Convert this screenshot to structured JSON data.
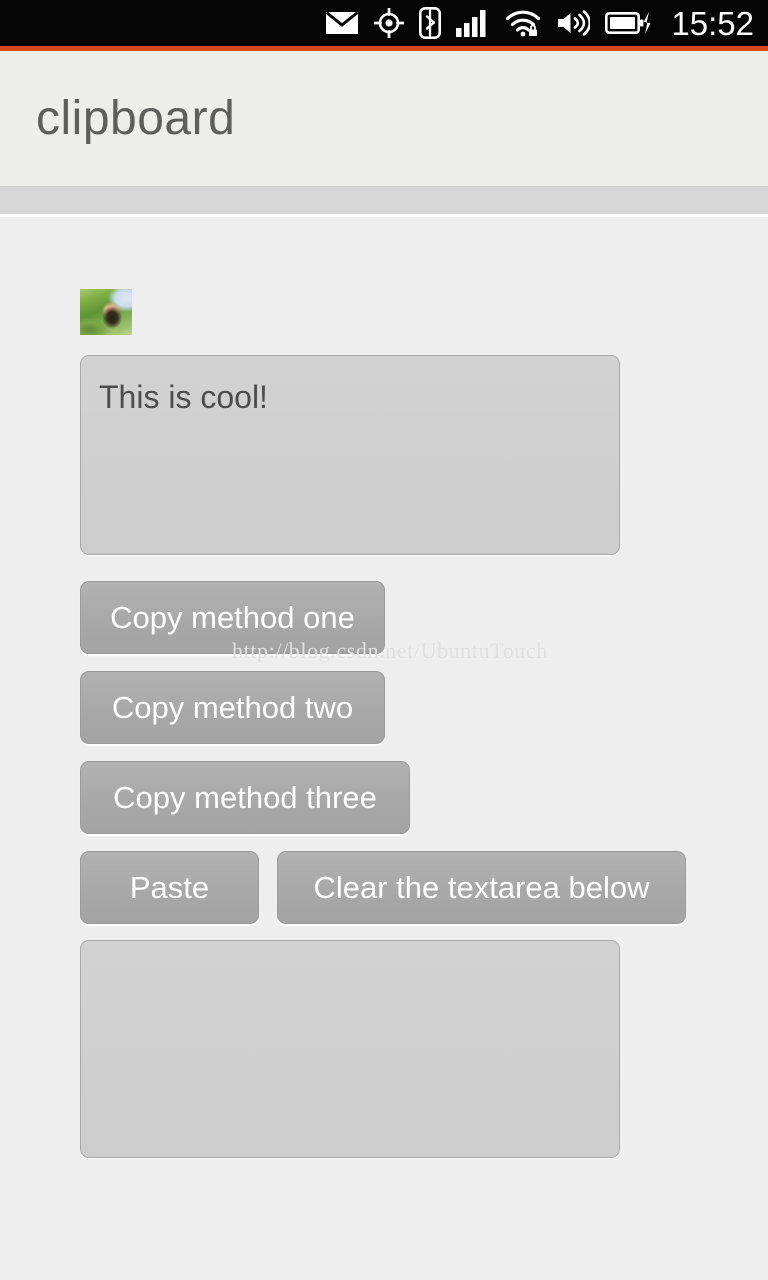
{
  "statusbar": {
    "icons": [
      {
        "name": "mail-icon",
        "label": "mail"
      },
      {
        "name": "location-icon",
        "label": "gps-location"
      },
      {
        "name": "bluetooth-icon",
        "label": "bluetooth"
      },
      {
        "name": "cellular-signal-icon",
        "label": "cellular-signal"
      },
      {
        "name": "wifi-secure-icon",
        "label": "wifi-secured"
      },
      {
        "name": "volume-icon",
        "label": "volume"
      },
      {
        "name": "battery-charging-icon",
        "label": "battery-charging"
      }
    ],
    "clock": "15:52",
    "background_color": "#050505",
    "icon_color": "#ffffff"
  },
  "accent": {
    "color": "#dd4814"
  },
  "header": {
    "title": "clipboard",
    "title_color": "#5e5e5e",
    "background_color": "#ededec"
  },
  "divider": {
    "band_color": "#d7d7d7",
    "underline_color": "#fcfcfc"
  },
  "content": {
    "background_color": "#eeeeee",
    "thumbnail": {
      "name": "clipboard-image-thumbnail",
      "alt": "pasted image thumbnail"
    },
    "textarea_top": {
      "value": "This is cool!",
      "placeholder": "",
      "fill_color": "#d0d0d0",
      "border_color": "#a9a9a9"
    },
    "textarea_bottom": {
      "value": "",
      "placeholder": "",
      "fill_color": "#d0d0d0",
      "border_color": "#a9a9a9"
    },
    "buttons": [
      {
        "id": "copy-one",
        "label": "Copy method one"
      },
      {
        "id": "copy-two",
        "label": "Copy method two"
      },
      {
        "id": "copy-three",
        "label": "Copy method three"
      },
      {
        "id": "paste",
        "label": "Paste"
      },
      {
        "id": "clear",
        "label": "Clear the textarea below"
      }
    ],
    "button_fill_color": "#a9a9a9",
    "button_text_color": "#ffffff"
  },
  "watermark": {
    "text": "http://blog.csdn.net/UbuntuTouch",
    "color": "#e0e0e0"
  }
}
